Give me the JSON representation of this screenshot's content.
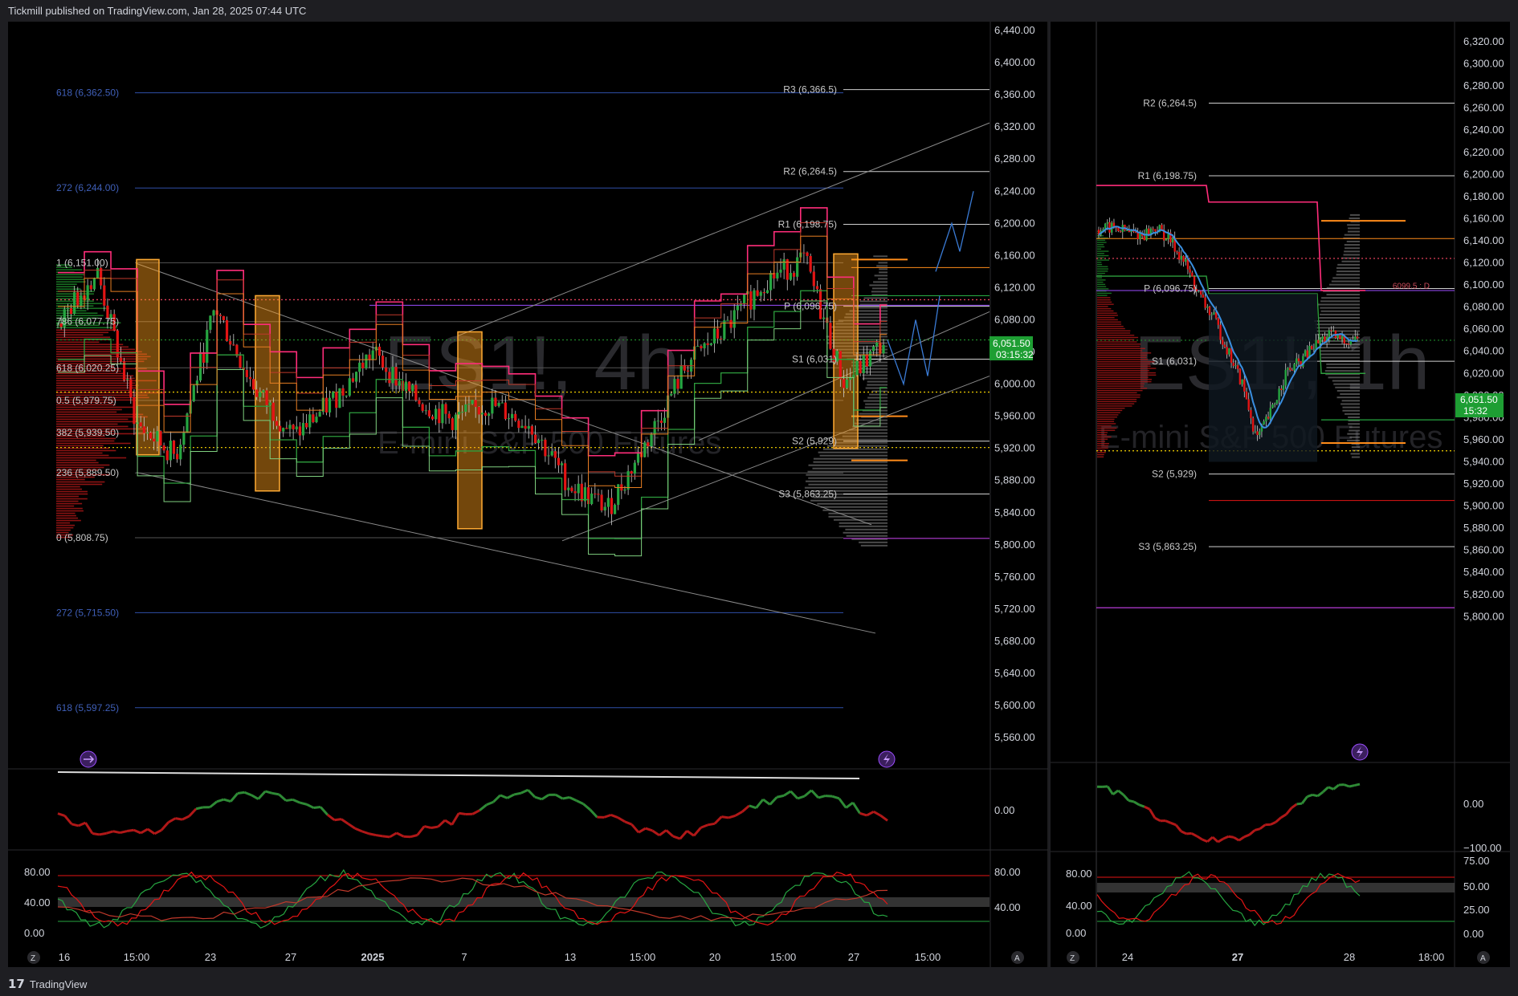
{
  "header": {
    "publisher": "Tickmill published on TradingView.com, Jan 28, 2025 07:44 UTC"
  },
  "footer": {
    "brand": "TradingView"
  },
  "left_chart": {
    "watermark": "ES1!, 4h",
    "watermark_sub": "E-mini S&P 500 Futures",
    "price_label": "6,051.50",
    "price_timer": "03:15:32",
    "y_ticks": [
      "6,440.00",
      "6,400.00",
      "6,360.00",
      "6,320.00",
      "6,280.00",
      "6,240.00",
      "6,200.00",
      "6,160.00",
      "6,120.00",
      "6,080.00",
      "6,040.00",
      "6,000.00",
      "5,960.00",
      "5,920.00",
      "5,880.00",
      "5,840.00",
      "5,800.00",
      "5,760.00",
      "5,720.00",
      "5,680.00",
      "5,640.00",
      "5,600.00",
      "5,560.00"
    ],
    "x_ticks": [
      "16",
      "15:00",
      "23",
      "27",
      "2025",
      "7",
      "13",
      "15:00",
      "20",
      "15:00",
      "27",
      "15:00"
    ],
    "fib_labels": [
      "618 (6,362.50)",
      "272 (6,244.00)",
      "1 (6,151.00)",
      "786 (6,077.75)",
      "618 (6,020.25)",
      "0.5 (5,979.75)",
      "382 (5,939.50)",
      "236 (5,889.50)",
      "0 (5,808.75)",
      "272 (5,715.50)",
      "618 (5,597.25)"
    ],
    "pivot_labels": [
      "R3 (6,366.5)",
      "R2 (6,264.5)",
      "R1 (6,198.75)",
      "P (6,096.75)",
      "S1 (6,031)",
      "S2 (5,929)",
      "S3 (5,863.25)"
    ],
    "osc_tick": "0.00",
    "stoch_ticks": [
      "80.00",
      "40.00",
      "0.00"
    ],
    "stoch_right_ticks": [
      "80.00",
      "40.00"
    ],
    "axis_buttons": [
      "Z",
      "A"
    ]
  },
  "right_chart": {
    "watermark": "ES1!, 1h",
    "watermark_sub": "E-mini S&P 500 Futures",
    "price_label": "6,051.50",
    "price_timer": "15:32",
    "poc_label": "6099.5 : D",
    "y_ticks": [
      "6,320.00",
      "6,300.00",
      "6,280.00",
      "6,260.00",
      "6,240.00",
      "6,220.00",
      "6,200.00",
      "6,180.00",
      "6,160.00",
      "6,140.00",
      "6,120.00",
      "6,100.00",
      "6,080.00",
      "6,060.00",
      "6,040.00",
      "6,020.00",
      "6,000.00",
      "5,980.00",
      "5,960.00",
      "5,940.00",
      "5,920.00",
      "5,900.00",
      "5,880.00",
      "5,860.00",
      "5,840.00",
      "5,820.00",
      "5,800.00"
    ],
    "x_ticks": [
      "24",
      "27",
      "28",
      "18:00"
    ],
    "pivot_labels": [
      "R2 (6,264.5)",
      "R1 (6,198.75)",
      "P (6,096.75)",
      "S1 (6,031)",
      "S2 (5,929)",
      "S3 (5,863.25)"
    ],
    "osc_ticks": [
      "0.00",
      "−100.00"
    ],
    "stoch_left_ticks": [
      "80.00",
      "40.00",
      "0.00"
    ],
    "stoch_right_ticks": [
      "75.00",
      "50.00",
      "25.00",
      "0.00"
    ],
    "axis_buttons": [
      "Z",
      "A"
    ]
  },
  "colors": {
    "bull": "#26a641",
    "bear": "#e31414",
    "pivot": "#cfcfcf",
    "fib": "#2f4fa8",
    "magenta": "#ff2d7a",
    "orange": "#ff8c1a",
    "profile_gray": "#8a8a8a",
    "profile_red": "#b01818",
    "profile_green": "#1e8a2a",
    "price_box": "#1e9e33"
  },
  "chart_data": [
    {
      "type": "line",
      "title": "ES1!, 4h",
      "ylim": [
        5540,
        6450
      ],
      "x": [
        "16",
        "15:00",
        "23",
        "27",
        "2025",
        "7",
        "13",
        "15:00",
        "20",
        "15:00",
        "27"
      ],
      "series": [
        {
          "values": [
            6075,
            6140,
            5950,
            5910,
            6095,
            5995,
            5935,
            5980,
            6040,
            5985,
            5955,
            5975,
            5950,
            5875,
            5845,
            5930,
            6025,
            6070,
            6130,
            6155,
            6000,
            6051.5
          ]
        }
      ],
      "pivots": {
        "R3": 6366.5,
        "R2": 6264.5,
        "R1": 6198.75,
        "P": 6096.75,
        "S1": 6031,
        "S2": 5929,
        "S3": 5863.25
      },
      "fib": {
        "618_top": 6362.5,
        "272_top": 6244,
        "1": 6151,
        "786": 6077.75,
        "618": 6020.25,
        "0.5": 5979.75,
        "382": 5939.5,
        "236": 5889.5,
        "0": 5808.75,
        "272_bottom": 5715.5,
        "618_bottom": 5597.25
      },
      "last_price": 6051.5
    },
    {
      "type": "line",
      "title": "ES1!, 1h",
      "ylim": [
        5790,
        6330
      ],
      "x": [
        "24",
        "27",
        "28",
        "18:00"
      ],
      "series": [
        {
          "values": [
            6150,
            6152,
            6148,
            6145,
            6152,
            6140,
            6120,
            6090,
            6070,
            6040,
            6010,
            5960,
            5985,
            6020,
            6030,
            6045,
            6055,
            6050,
            6051.5
          ]
        }
      ],
      "pivots": {
        "R2": 6264.5,
        "R1": 6198.75,
        "P": 6096.75,
        "S1": 6031,
        "S2": 5929,
        "S3": 5863.25
      },
      "last_price": 6051.5
    }
  ]
}
